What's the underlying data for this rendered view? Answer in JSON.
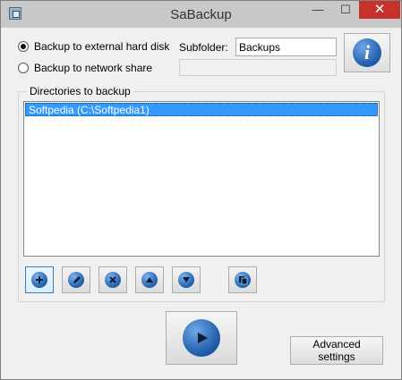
{
  "window": {
    "title": "SaBackup",
    "minimize_glyph": "—",
    "maximize_glyph": "☐",
    "close_glyph": "✕"
  },
  "destination": {
    "options": [
      {
        "label": "Backup to external hard disk",
        "selected": true
      },
      {
        "label": "Backup to network share",
        "selected": false
      }
    ],
    "subfolder_label": "Subfolder:",
    "subfolder_value": "Backups",
    "network_path_value": ""
  },
  "info_button": {
    "icon": "info-icon",
    "glyph": "i"
  },
  "directories": {
    "title": "Directories to backup",
    "items": [
      {
        "label": "Softpedia (C:\\Softpedia1)",
        "selected": true
      }
    ]
  },
  "toolbar": {
    "buttons": [
      {
        "name": "add-directory-button",
        "icon": "plus-icon"
      },
      {
        "name": "edit-directory-button",
        "icon": "pencil-icon"
      },
      {
        "name": "remove-directory-button",
        "icon": "delete-icon"
      },
      {
        "name": "move-up-button",
        "icon": "arrow-up-icon"
      },
      {
        "name": "move-down-button",
        "icon": "arrow-down-icon"
      },
      {
        "name": "copy-button",
        "icon": "copy-icon"
      }
    ]
  },
  "actions": {
    "start_icon": "play-icon",
    "advanced_label": "Advanced settings"
  },
  "colors": {
    "accent": "#3399ff",
    "title_bar": "#c8c8c8",
    "close_button": "#c7312c",
    "icon_blue": "#1d5aa8"
  }
}
